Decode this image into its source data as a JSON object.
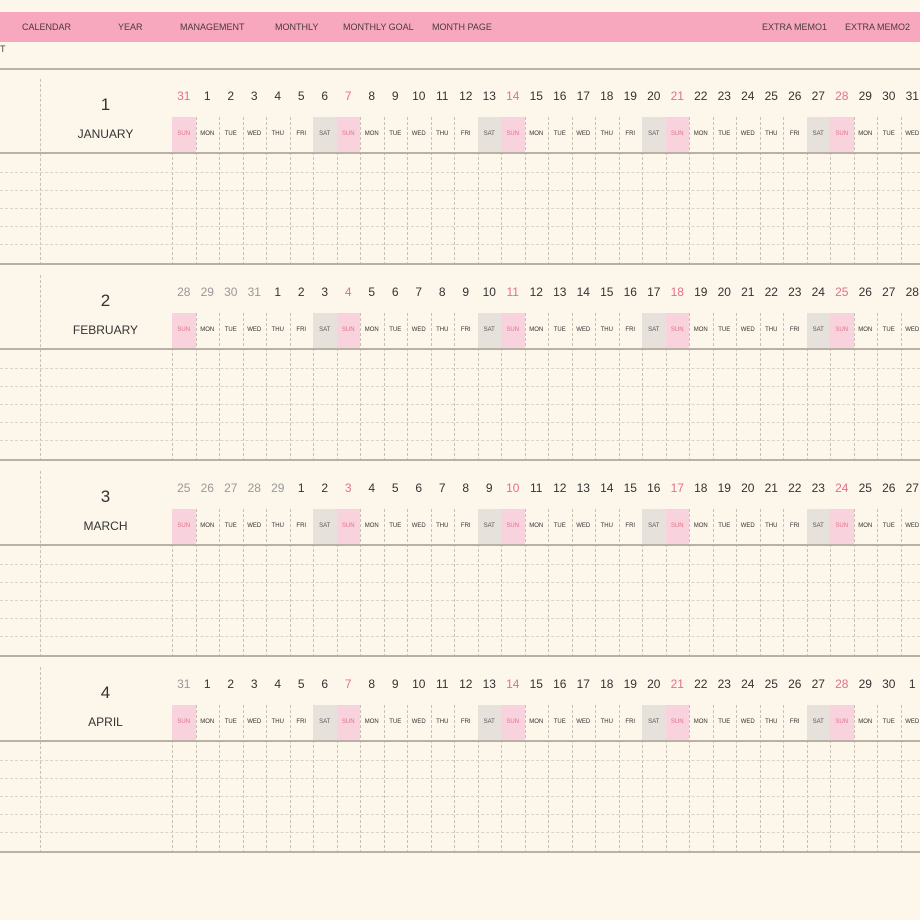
{
  "nav": {
    "items": [
      {
        "id": "calendar",
        "label": "CALENDAR"
      },
      {
        "id": "year",
        "label": "YEAR"
      },
      {
        "id": "management",
        "label": "MANAGEMENT"
      },
      {
        "id": "monthly",
        "label": "MONTHLY"
      },
      {
        "id": "monthly-goal",
        "label": "MONTHLY GOAL"
      },
      {
        "id": "month-page",
        "label": "MONTH PAGE"
      },
      {
        "id": "extra-memo1",
        "label": "EXTRA MEMO1"
      },
      {
        "id": "extra-memo2",
        "label": "EXTRA MEMO2"
      }
    ],
    "stub": "T"
  },
  "colors": {
    "nav_bg": "#f7a8bf",
    "page_bg": "#fdf6ea",
    "sunday": "#e2718b",
    "sunday_bg": "#f8d2dc",
    "saturday_bg": "#e6e2db"
  },
  "months": [
    {
      "number": "1",
      "name": "JANUARY",
      "days": [
        {
          "n": "31",
          "w": "SUN",
          "t": "sun"
        },
        {
          "n": "1",
          "w": "MON"
        },
        {
          "n": "2",
          "w": "TUE"
        },
        {
          "n": "3",
          "w": "WED"
        },
        {
          "n": "4",
          "w": "THU"
        },
        {
          "n": "5",
          "w": "FRI"
        },
        {
          "n": "6",
          "w": "SAT",
          "t": "sat"
        },
        {
          "n": "7",
          "w": "SUN",
          "t": "sun"
        },
        {
          "n": "8",
          "w": "MON"
        },
        {
          "n": "9",
          "w": "TUE"
        },
        {
          "n": "10",
          "w": "WED"
        },
        {
          "n": "11",
          "w": "THU"
        },
        {
          "n": "12",
          "w": "FRI"
        },
        {
          "n": "13",
          "w": "SAT",
          "t": "sat"
        },
        {
          "n": "14",
          "w": "SUN",
          "t": "sun"
        },
        {
          "n": "15",
          "w": "MON"
        },
        {
          "n": "16",
          "w": "TUE"
        },
        {
          "n": "17",
          "w": "WED"
        },
        {
          "n": "18",
          "w": "THU"
        },
        {
          "n": "19",
          "w": "FRI"
        },
        {
          "n": "20",
          "w": "SAT",
          "t": "sat"
        },
        {
          "n": "21",
          "w": "SUN",
          "t": "sun"
        },
        {
          "n": "22",
          "w": "MON"
        },
        {
          "n": "23",
          "w": "TUE"
        },
        {
          "n": "24",
          "w": "WED"
        },
        {
          "n": "25",
          "w": "THU"
        },
        {
          "n": "26",
          "w": "FRI"
        },
        {
          "n": "27",
          "w": "SAT",
          "t": "sat"
        },
        {
          "n": "28",
          "w": "SUN",
          "t": "sun"
        },
        {
          "n": "29",
          "w": "MON"
        },
        {
          "n": "30",
          "w": "TUE"
        },
        {
          "n": "31",
          "w": "WED"
        }
      ]
    },
    {
      "number": "2",
      "name": "FEBRUARY",
      "days": [
        {
          "n": "28",
          "w": "SUN",
          "t": "sun",
          "o": true
        },
        {
          "n": "29",
          "w": "MON",
          "o": true
        },
        {
          "n": "30",
          "w": "TUE",
          "o": true
        },
        {
          "n": "31",
          "w": "WED",
          "o": true
        },
        {
          "n": "1",
          "w": "THU"
        },
        {
          "n": "2",
          "w": "FRI"
        },
        {
          "n": "3",
          "w": "SAT",
          "t": "sat"
        },
        {
          "n": "4",
          "w": "SUN",
          "t": "sun"
        },
        {
          "n": "5",
          "w": "MON"
        },
        {
          "n": "6",
          "w": "TUE"
        },
        {
          "n": "7",
          "w": "WED"
        },
        {
          "n": "8",
          "w": "THU"
        },
        {
          "n": "9",
          "w": "FRI"
        },
        {
          "n": "10",
          "w": "SAT",
          "t": "sat"
        },
        {
          "n": "11",
          "w": "SUN",
          "t": "sun"
        },
        {
          "n": "12",
          "w": "MON"
        },
        {
          "n": "13",
          "w": "TUE"
        },
        {
          "n": "14",
          "w": "WED"
        },
        {
          "n": "15",
          "w": "THU"
        },
        {
          "n": "16",
          "w": "FRI"
        },
        {
          "n": "17",
          "w": "SAT",
          "t": "sat"
        },
        {
          "n": "18",
          "w": "SUN",
          "t": "sun"
        },
        {
          "n": "19",
          "w": "MON"
        },
        {
          "n": "20",
          "w": "TUE"
        },
        {
          "n": "21",
          "w": "WED"
        },
        {
          "n": "22",
          "w": "THU"
        },
        {
          "n": "23",
          "w": "FRI"
        },
        {
          "n": "24",
          "w": "SAT",
          "t": "sat"
        },
        {
          "n": "25",
          "w": "SUN",
          "t": "sun"
        },
        {
          "n": "26",
          "w": "MON"
        },
        {
          "n": "27",
          "w": "TUE"
        },
        {
          "n": "28",
          "w": "WED"
        }
      ]
    },
    {
      "number": "3",
      "name": "MARCH",
      "days": [
        {
          "n": "25",
          "w": "SUN",
          "t": "sun",
          "o": true
        },
        {
          "n": "26",
          "w": "MON",
          "o": true
        },
        {
          "n": "27",
          "w": "TUE",
          "o": true
        },
        {
          "n": "28",
          "w": "WED",
          "o": true
        },
        {
          "n": "29",
          "w": "THU",
          "o": true
        },
        {
          "n": "1",
          "w": "FRI"
        },
        {
          "n": "2",
          "w": "SAT",
          "t": "sat"
        },
        {
          "n": "3",
          "w": "SUN",
          "t": "sun"
        },
        {
          "n": "4",
          "w": "MON"
        },
        {
          "n": "5",
          "w": "TUE"
        },
        {
          "n": "6",
          "w": "WED"
        },
        {
          "n": "7",
          "w": "THU"
        },
        {
          "n": "8",
          "w": "FRI"
        },
        {
          "n": "9",
          "w": "SAT",
          "t": "sat"
        },
        {
          "n": "10",
          "w": "SUN",
          "t": "sun"
        },
        {
          "n": "11",
          "w": "MON"
        },
        {
          "n": "12",
          "w": "TUE"
        },
        {
          "n": "13",
          "w": "WED"
        },
        {
          "n": "14",
          "w": "THU"
        },
        {
          "n": "15",
          "w": "FRI"
        },
        {
          "n": "16",
          "w": "SAT",
          "t": "sat"
        },
        {
          "n": "17",
          "w": "SUN",
          "t": "sun"
        },
        {
          "n": "18",
          "w": "MON"
        },
        {
          "n": "19",
          "w": "TUE"
        },
        {
          "n": "20",
          "w": "WED"
        },
        {
          "n": "21",
          "w": "THU"
        },
        {
          "n": "22",
          "w": "FRI"
        },
        {
          "n": "23",
          "w": "SAT",
          "t": "sat"
        },
        {
          "n": "24",
          "w": "SUN",
          "t": "sun"
        },
        {
          "n": "25",
          "w": "MON"
        },
        {
          "n": "26",
          "w": "TUE"
        },
        {
          "n": "27",
          "w": "WED"
        }
      ]
    },
    {
      "number": "4",
      "name": "APRIL",
      "days": [
        {
          "n": "31",
          "w": "SUN",
          "t": "sun",
          "o": true
        },
        {
          "n": "1",
          "w": "MON"
        },
        {
          "n": "2",
          "w": "TUE"
        },
        {
          "n": "3",
          "w": "WED"
        },
        {
          "n": "4",
          "w": "THU"
        },
        {
          "n": "5",
          "w": "FRI"
        },
        {
          "n": "6",
          "w": "SAT",
          "t": "sat"
        },
        {
          "n": "7",
          "w": "SUN",
          "t": "sun"
        },
        {
          "n": "8",
          "w": "MON"
        },
        {
          "n": "9",
          "w": "TUE"
        },
        {
          "n": "10",
          "w": "WED"
        },
        {
          "n": "11",
          "w": "THU"
        },
        {
          "n": "12",
          "w": "FRI"
        },
        {
          "n": "13",
          "w": "SAT",
          "t": "sat"
        },
        {
          "n": "14",
          "w": "SUN",
          "t": "sun"
        },
        {
          "n": "15",
          "w": "MON"
        },
        {
          "n": "16",
          "w": "TUE"
        },
        {
          "n": "17",
          "w": "WED"
        },
        {
          "n": "18",
          "w": "THU"
        },
        {
          "n": "19",
          "w": "FRI"
        },
        {
          "n": "20",
          "w": "SAT",
          "t": "sat"
        },
        {
          "n": "21",
          "w": "SUN",
          "t": "sun"
        },
        {
          "n": "22",
          "w": "MON"
        },
        {
          "n": "23",
          "w": "TUE"
        },
        {
          "n": "24",
          "w": "WED"
        },
        {
          "n": "25",
          "w": "THU"
        },
        {
          "n": "26",
          "w": "FRI"
        },
        {
          "n": "27",
          "w": "SAT",
          "t": "sat"
        },
        {
          "n": "28",
          "w": "SUN",
          "t": "sun"
        },
        {
          "n": "29",
          "w": "MON"
        },
        {
          "n": "30",
          "w": "TUE"
        },
        {
          "n": "1",
          "w": "WED"
        }
      ]
    }
  ]
}
